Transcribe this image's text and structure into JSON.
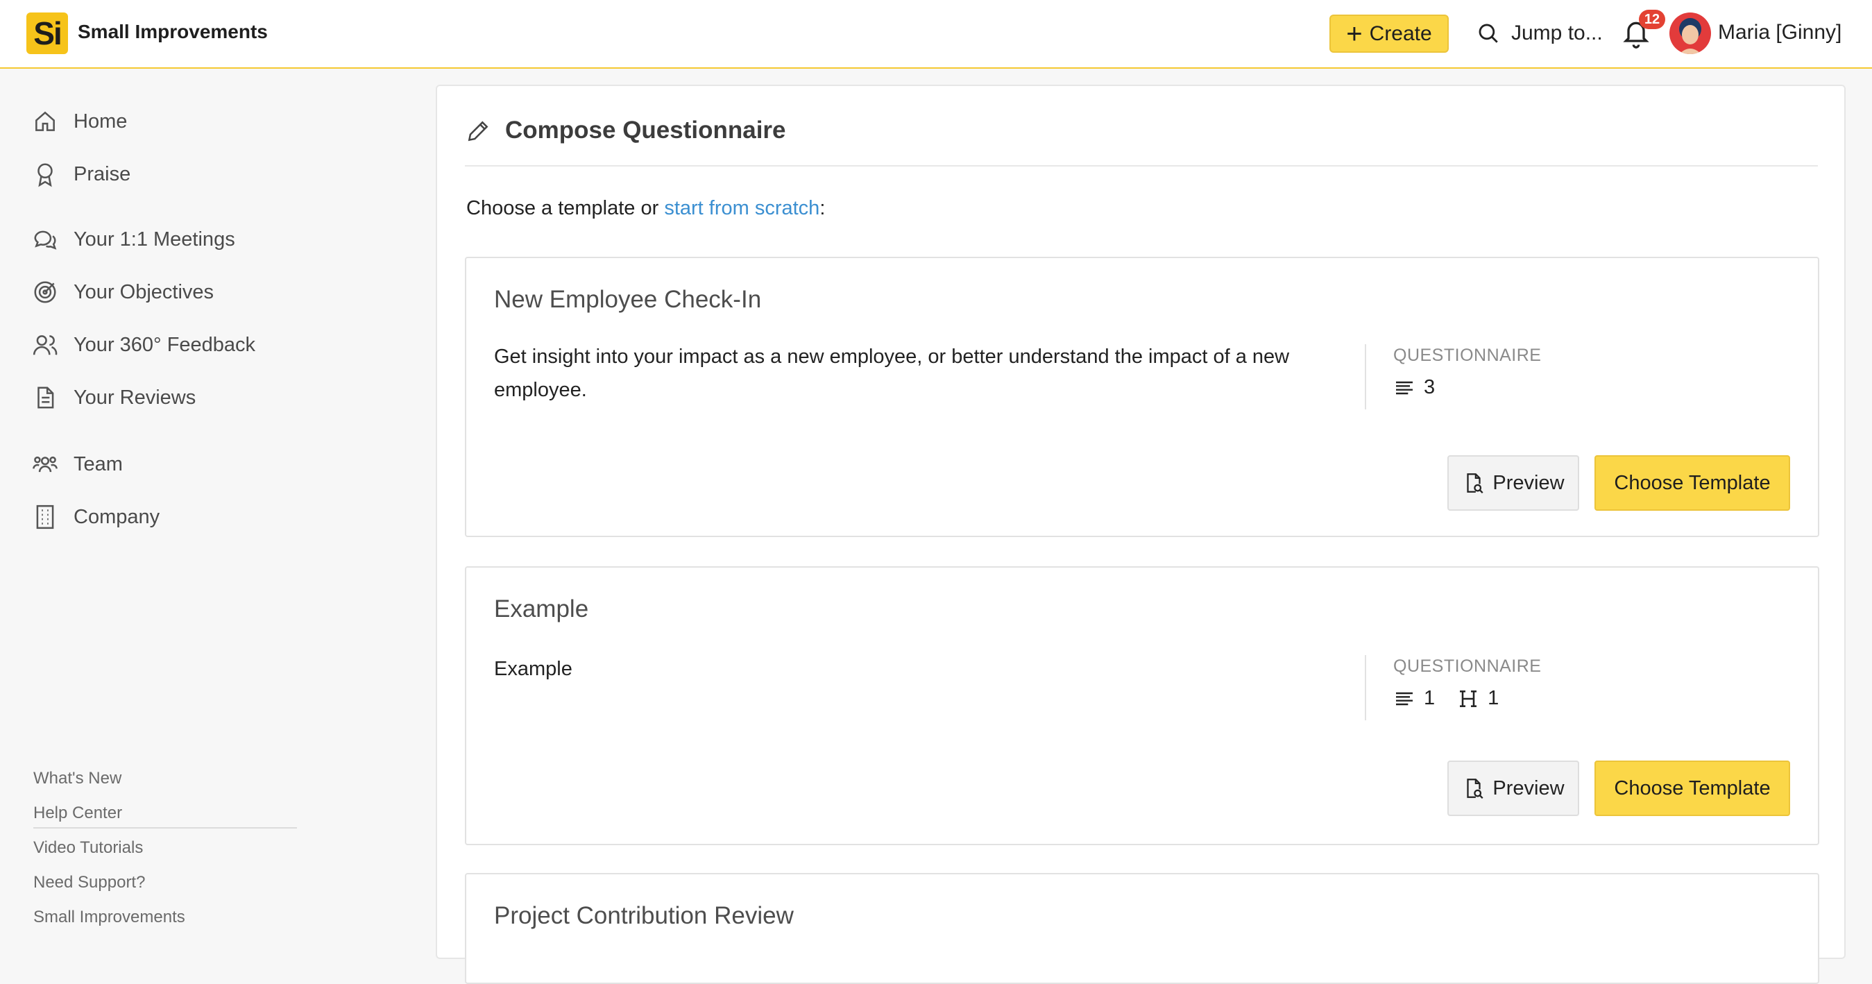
{
  "app": {
    "logo_text": "Si",
    "brand": "Small Improvements"
  },
  "topbar": {
    "create_label": "Create",
    "jump_label": "Jump to...",
    "notification_count": "12",
    "user_name": "Maria [Ginny]"
  },
  "sidebar": {
    "items": [
      {
        "label": "Home",
        "icon": "home-icon"
      },
      {
        "label": "Praise",
        "icon": "award-icon"
      },
      {
        "label": "Your 1:1 Meetings",
        "icon": "chat-icon"
      },
      {
        "label": "Your Objectives",
        "icon": "target-icon"
      },
      {
        "label": "Your 360° Feedback",
        "icon": "people-icon"
      },
      {
        "label": "Your Reviews",
        "icon": "document-icon"
      },
      {
        "label": "Team",
        "icon": "team-icon"
      },
      {
        "label": "Company",
        "icon": "building-icon"
      }
    ],
    "footer_links": [
      "What's New",
      "Help Center",
      "Video Tutorials",
      "Need Support?",
      "Small Improvements"
    ]
  },
  "main": {
    "title": "Compose Questionnaire",
    "intro_prefix": "Choose a template or ",
    "intro_link": "start from scratch",
    "intro_suffix": ":",
    "templates": [
      {
        "title": "New Employee Check-In",
        "description": "Get insight into your impact as a new employee, or better understand the impact of a new employee.",
        "type": "QUESTIONNAIRE",
        "text_questions": "3",
        "heading_count": "",
        "preview_label": "Preview",
        "choose_label": "Choose Template"
      },
      {
        "title": "Example",
        "description": "Example",
        "type": "QUESTIONNAIRE",
        "text_questions": "1",
        "heading_count": "1",
        "preview_label": "Preview",
        "choose_label": "Choose Template"
      },
      {
        "title": "Project Contribution Review"
      }
    ]
  },
  "colors": {
    "accent": "#fbd748",
    "link": "#3b8fd1",
    "badge": "#e34233"
  }
}
